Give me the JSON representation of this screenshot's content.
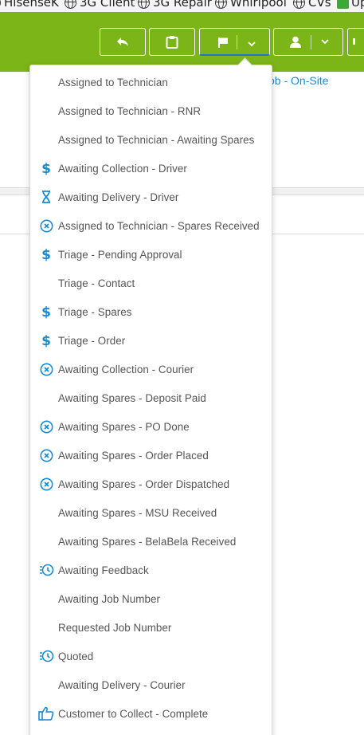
{
  "bookmarks": [
    {
      "label": "HisenseK",
      "icon": "globe-icon"
    },
    {
      "label": "3G Client",
      "icon": "globe-icon"
    },
    {
      "label": "3G Repair",
      "icon": "globe-icon"
    },
    {
      "label": "Whirlpool",
      "icon": "globe-icon"
    },
    {
      "label": "CVs",
      "icon": "globe-icon"
    },
    {
      "label": "Up",
      "icon": "app-icon"
    }
  ],
  "toolbar": {
    "buttons": [
      {
        "name": "reply-button",
        "icon": "reply-icon"
      },
      {
        "name": "clipboard-button",
        "icon": "clipboard-icon"
      },
      {
        "name": "status-flag-button",
        "icon": "flag-icon",
        "has_dropdown": true,
        "active": true
      },
      {
        "name": "assign-user-button",
        "icon": "user-icon",
        "has_dropdown": true
      }
    ]
  },
  "background": {
    "link_text": "ob - On-Site"
  },
  "colors": {
    "header_green": "#7cb518",
    "accent_blue": "#1c78bf",
    "icon_blue": "#1a8ad0",
    "menu_text": "#555555"
  },
  "status_menu": {
    "items": [
      {
        "label": "Assigned to Technician",
        "icon": ""
      },
      {
        "label": "Assigned to Technician - RNR",
        "icon": ""
      },
      {
        "label": "Assigned to Technician - Awaiting Spares",
        "icon": ""
      },
      {
        "label": "Awaiting Collection - Driver",
        "icon": "dollar-icon"
      },
      {
        "label": "Awaiting Delivery - Driver",
        "icon": "hourglass-icon"
      },
      {
        "label": "Assigned to Technician - Spares Received",
        "icon": "circle-x-icon"
      },
      {
        "label": "Triage - Pending Approval",
        "icon": "dollar-icon"
      },
      {
        "label": "Triage - Contact",
        "icon": ""
      },
      {
        "label": "Triage - Spares",
        "icon": "dollar-icon"
      },
      {
        "label": "Triage - Order",
        "icon": "dollar-icon"
      },
      {
        "label": "Awaiting Collection - Courier",
        "icon": "circle-x-icon"
      },
      {
        "label": "Awaiting Spares - Deposit Paid",
        "icon": ""
      },
      {
        "label": "Awaiting Spares - PO Done",
        "icon": "circle-x-icon"
      },
      {
        "label": "Awaiting Spares - Order Placed",
        "icon": "circle-x-icon"
      },
      {
        "label": "Awaiting Spares - Order Dispatched",
        "icon": "circle-x-icon"
      },
      {
        "label": "Awaiting Spares - MSU Received",
        "icon": ""
      },
      {
        "label": "Awaiting Spares - BelaBela Received",
        "icon": ""
      },
      {
        "label": "Awaiting Feedback",
        "icon": "history-icon"
      },
      {
        "label": "Awaiting Job Number",
        "icon": ""
      },
      {
        "label": "Requested Job Number",
        "icon": ""
      },
      {
        "label": "Quoted",
        "icon": "history-icon"
      },
      {
        "label": "Awaiting Delivery - Courier",
        "icon": ""
      },
      {
        "label": "Customer to Collect - Complete",
        "icon": "thumbs-up-icon"
      }
    ]
  }
}
